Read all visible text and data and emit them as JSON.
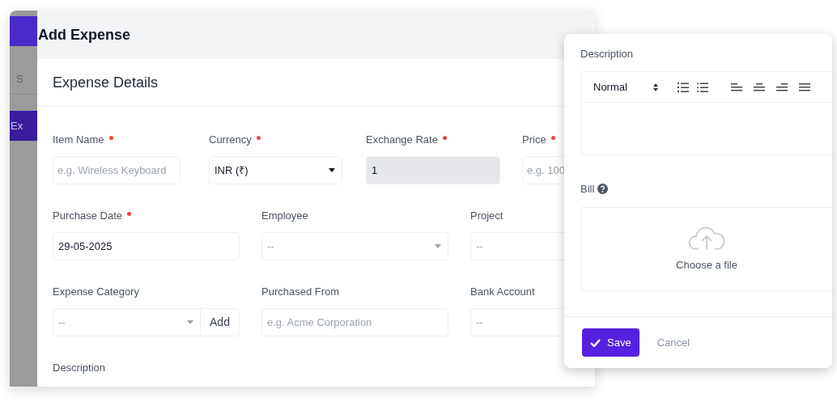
{
  "sidebar": {
    "items": [
      {
        "label": "S",
        "selected": false
      },
      {
        "label": "Ex",
        "selected": true
      }
    ]
  },
  "modal": {
    "title": "Add Expense",
    "section_title": "Expense Details",
    "rows": [
      [
        {
          "label": "Item Name",
          "required": true,
          "kind": "text",
          "placeholder": "e.g. Wireless Keyboard"
        },
        {
          "label": "Currency",
          "required": true,
          "kind": "select",
          "value": "INR (₹)"
        },
        {
          "label": "Exchange Rate",
          "required": true,
          "kind": "readonly",
          "value": "1"
        },
        {
          "label": "Price",
          "required": true,
          "kind": "text",
          "placeholder": "e.g. 100"
        }
      ],
      [
        {
          "label": "Purchase Date",
          "required": true,
          "kind": "text",
          "value": "29-05-2025"
        },
        {
          "label": "Employee",
          "required": false,
          "kind": "select",
          "placeholder": "--"
        },
        {
          "label": "Project",
          "required": false,
          "kind": "text",
          "placeholder": "--"
        }
      ],
      [
        {
          "label": "Expense Category",
          "required": false,
          "kind": "select-add",
          "placeholder": "--",
          "add_label": "Add"
        },
        {
          "label": "Purchased From",
          "required": false,
          "kind": "text",
          "placeholder": "e.g. Acme Corporation"
        },
        {
          "label": "Bank Account",
          "required": false,
          "kind": "text",
          "placeholder": "--"
        }
      ]
    ],
    "description_label": "Description"
  },
  "panel": {
    "description_label": "Description",
    "editor": {
      "heading_style": "Normal"
    },
    "bill_label": "Bill",
    "upload_text": "Choose a file",
    "save": "Save",
    "cancel": "Cancel"
  }
}
